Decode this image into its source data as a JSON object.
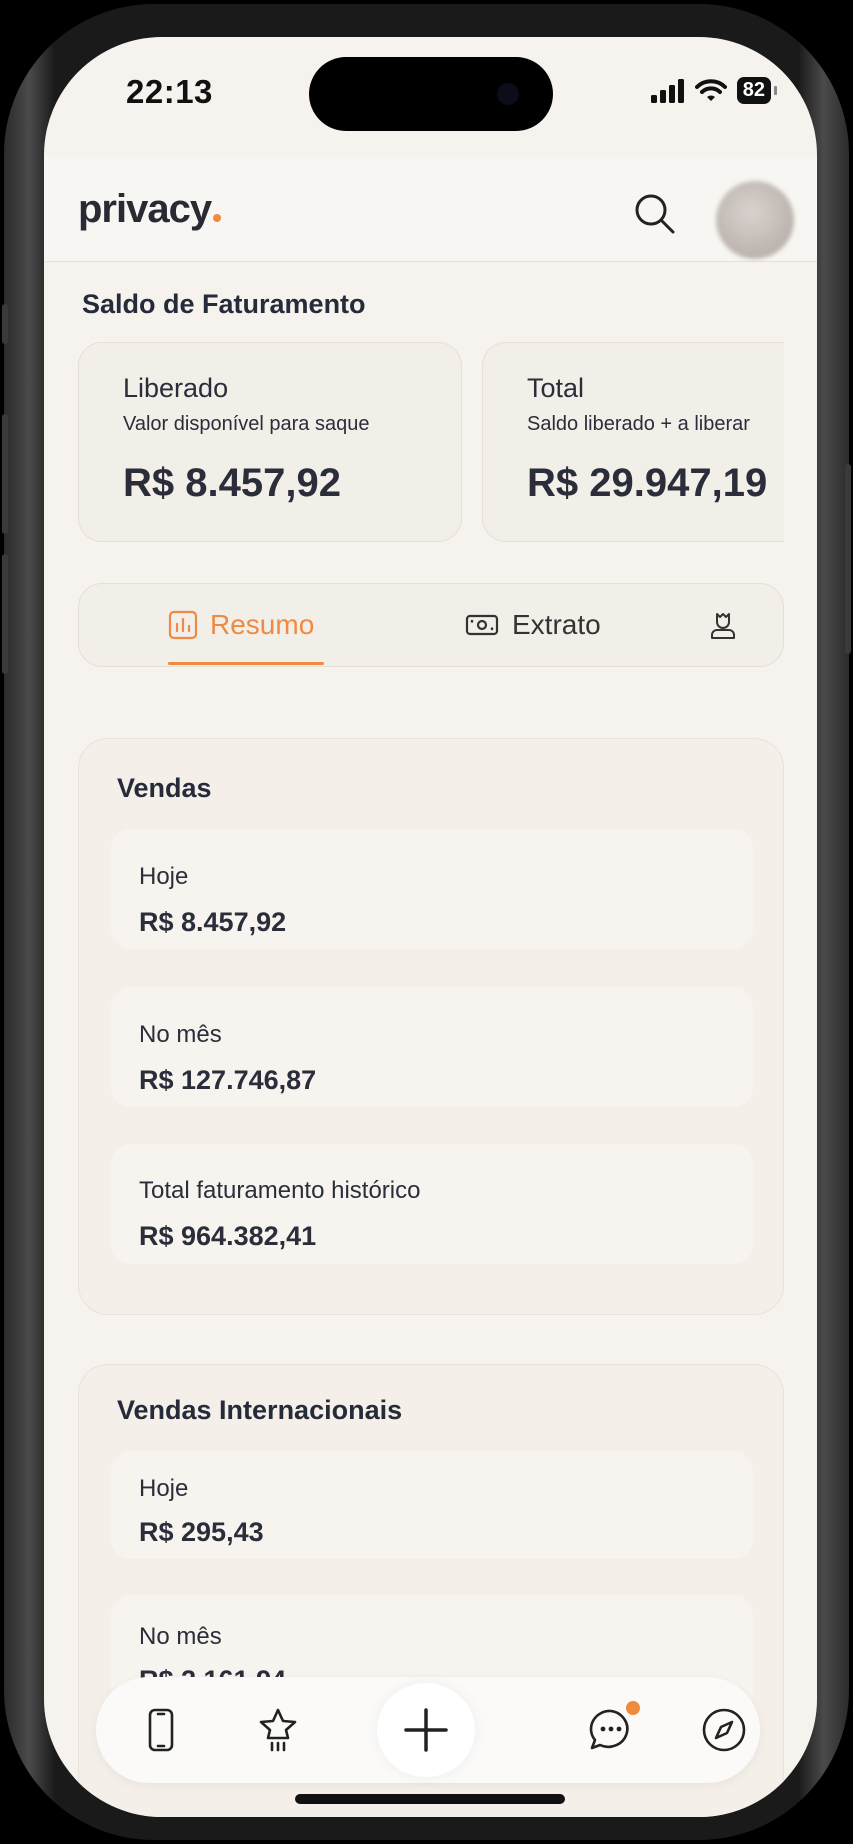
{
  "status_bar": {
    "time": "22:13",
    "battery": "82"
  },
  "header": {
    "logo": "privacy",
    "logo_dot_color": "#f08a3c",
    "search_icon": "search-icon",
    "avatar_icon": "avatar"
  },
  "balance": {
    "section_title": "Saldo de Faturamento",
    "cards": [
      {
        "title": "Liberado",
        "subtitle": "Valor disponível para saque",
        "value": "R$ 8.457,92"
      },
      {
        "title": "Total",
        "subtitle": "Saldo liberado + a liberar",
        "value": "R$ 29.947,19"
      }
    ]
  },
  "tabs": [
    {
      "label": "Resumo",
      "icon": "bar-chart-icon",
      "active": true
    },
    {
      "label": "Extrato",
      "icon": "money-bill-icon",
      "active": false
    },
    {
      "label": "",
      "icon": "user-icon",
      "active": false
    }
  ],
  "accent_color": "#ef8a45",
  "sales": {
    "title": "Vendas",
    "rows": [
      {
        "label": "Hoje",
        "value": "R$ 8.457,92"
      },
      {
        "label": "No mês",
        "value": "R$ 127.746,87"
      },
      {
        "label": "Total faturamento histórico",
        "value": "R$ 964.382,41"
      }
    ]
  },
  "international_sales": {
    "title": "Vendas Internacionais",
    "rows": [
      {
        "label": "Hoje",
        "value": "R$ 295,43"
      },
      {
        "label": "No mês",
        "value": "R$ 2.161,94"
      }
    ]
  },
  "bottom_nav": [
    {
      "icon": "phone-icon"
    },
    {
      "icon": "star-icon"
    },
    {
      "icon": "plus-icon"
    },
    {
      "icon": "chat-icon",
      "badge": true
    },
    {
      "icon": "compass-icon"
    }
  ]
}
